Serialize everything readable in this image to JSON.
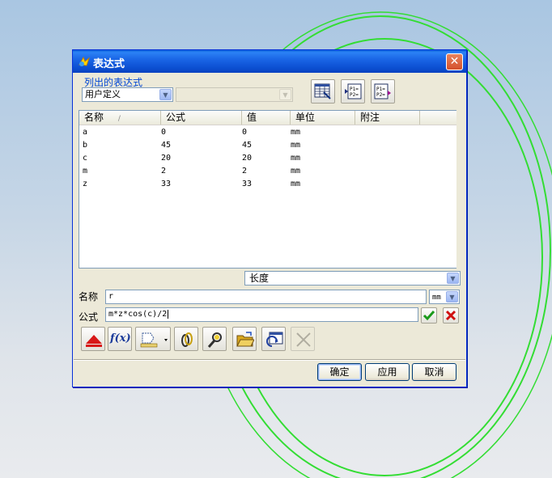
{
  "window": {
    "title": "表达式",
    "close_glyph": "✕"
  },
  "list_group": {
    "label": "列出的表达式",
    "filter_value": "用户定义",
    "secondary_value": ""
  },
  "toolbar_top": {
    "icons": [
      "spreadsheet-edit-icon",
      "list-parameters-icon",
      "list-parameters-export-icon"
    ]
  },
  "table": {
    "columns": [
      "名称",
      "公式",
      "值",
      "单位",
      "附注"
    ],
    "sort_glyph": "/",
    "rows": [
      {
        "name": "a",
        "formula": "0",
        "value": "0",
        "unit": "mm",
        "note": ""
      },
      {
        "name": "b",
        "formula": "45",
        "value": "45",
        "unit": "mm",
        "note": ""
      },
      {
        "name": "c",
        "formula": "20",
        "value": "20",
        "unit": "mm",
        "note": ""
      },
      {
        "name": "m",
        "formula": "2",
        "value": "2",
        "unit": "mm",
        "note": ""
      },
      {
        "name": "z",
        "formula": "33",
        "value": "33",
        "unit": "mm",
        "note": ""
      }
    ]
  },
  "type_select": {
    "value": "长度"
  },
  "name_field": {
    "label": "名称",
    "value": "r",
    "unit": "mm"
  },
  "formula_field": {
    "label": "公式",
    "value": "m*z*cos(c)/2"
  },
  "tools": {
    "fx_label": "f(x)"
  },
  "buttons": {
    "ok": "确定",
    "apply": "应用",
    "cancel": "取消"
  },
  "colors": {
    "titlebar": "#0a5fd9",
    "background_arcs": "#33dd33",
    "dialog_face": "#ece9d8"
  }
}
